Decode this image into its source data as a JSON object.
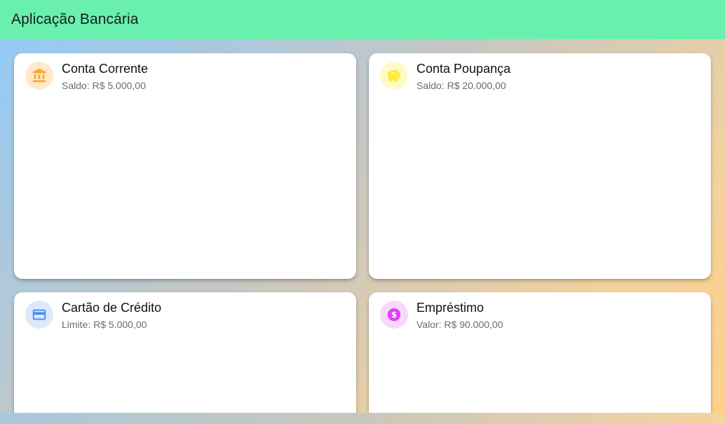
{
  "app_bar": {
    "title": "Aplicação Bancária",
    "color": "#69f0ae"
  },
  "cards": [
    {
      "title": "Conta Corrente",
      "subtitle": "Saldo: R$ 5.000,00",
      "icon": "bank-icon",
      "icon_color": "#ffa726",
      "icon_bg": "#ffe8cc"
    },
    {
      "title": "Conta Poupança",
      "subtitle": "Saldo: R$ 20.000,00",
      "icon": "piggy-bank-icon",
      "icon_color": "#ffeb3b",
      "icon_bg": "#fffbc8"
    },
    {
      "title": "Cartão de Crédito",
      "subtitle": "Limite: R$ 5.000,00",
      "icon": "credit-card-icon",
      "icon_color": "#448aff",
      "icon_bg": "#dce8fb"
    },
    {
      "title": "Empréstimo",
      "subtitle": "Valor: R$ 90.000,00",
      "icon": "dollar-circle-icon",
      "icon_color": "#e040fb",
      "icon_bg": "#f7d9fb"
    }
  ]
}
